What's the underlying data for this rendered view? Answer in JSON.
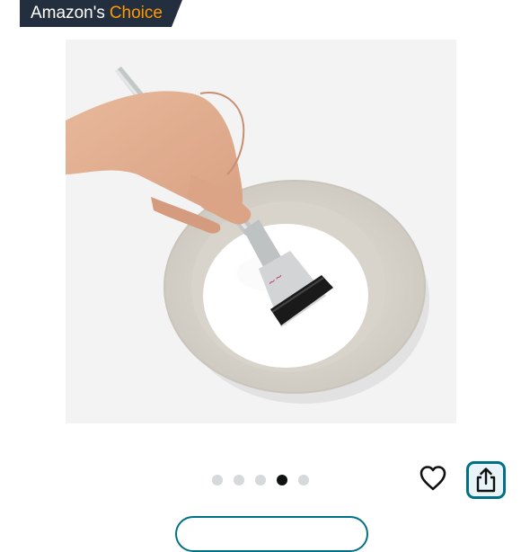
{
  "badge": {
    "label": "Amazon's",
    "accent": "Choice"
  },
  "carousel": {
    "total": 5,
    "current": 4
  },
  "icons": {
    "wishlist": "heart-icon",
    "share": "share-icon"
  },
  "colors": {
    "badge_bg": "#232f3e",
    "badge_accent": "#ff9900",
    "dot_active": "#0f1111",
    "dot_inactive": "#d5d9d9",
    "share_border": "#007185"
  }
}
